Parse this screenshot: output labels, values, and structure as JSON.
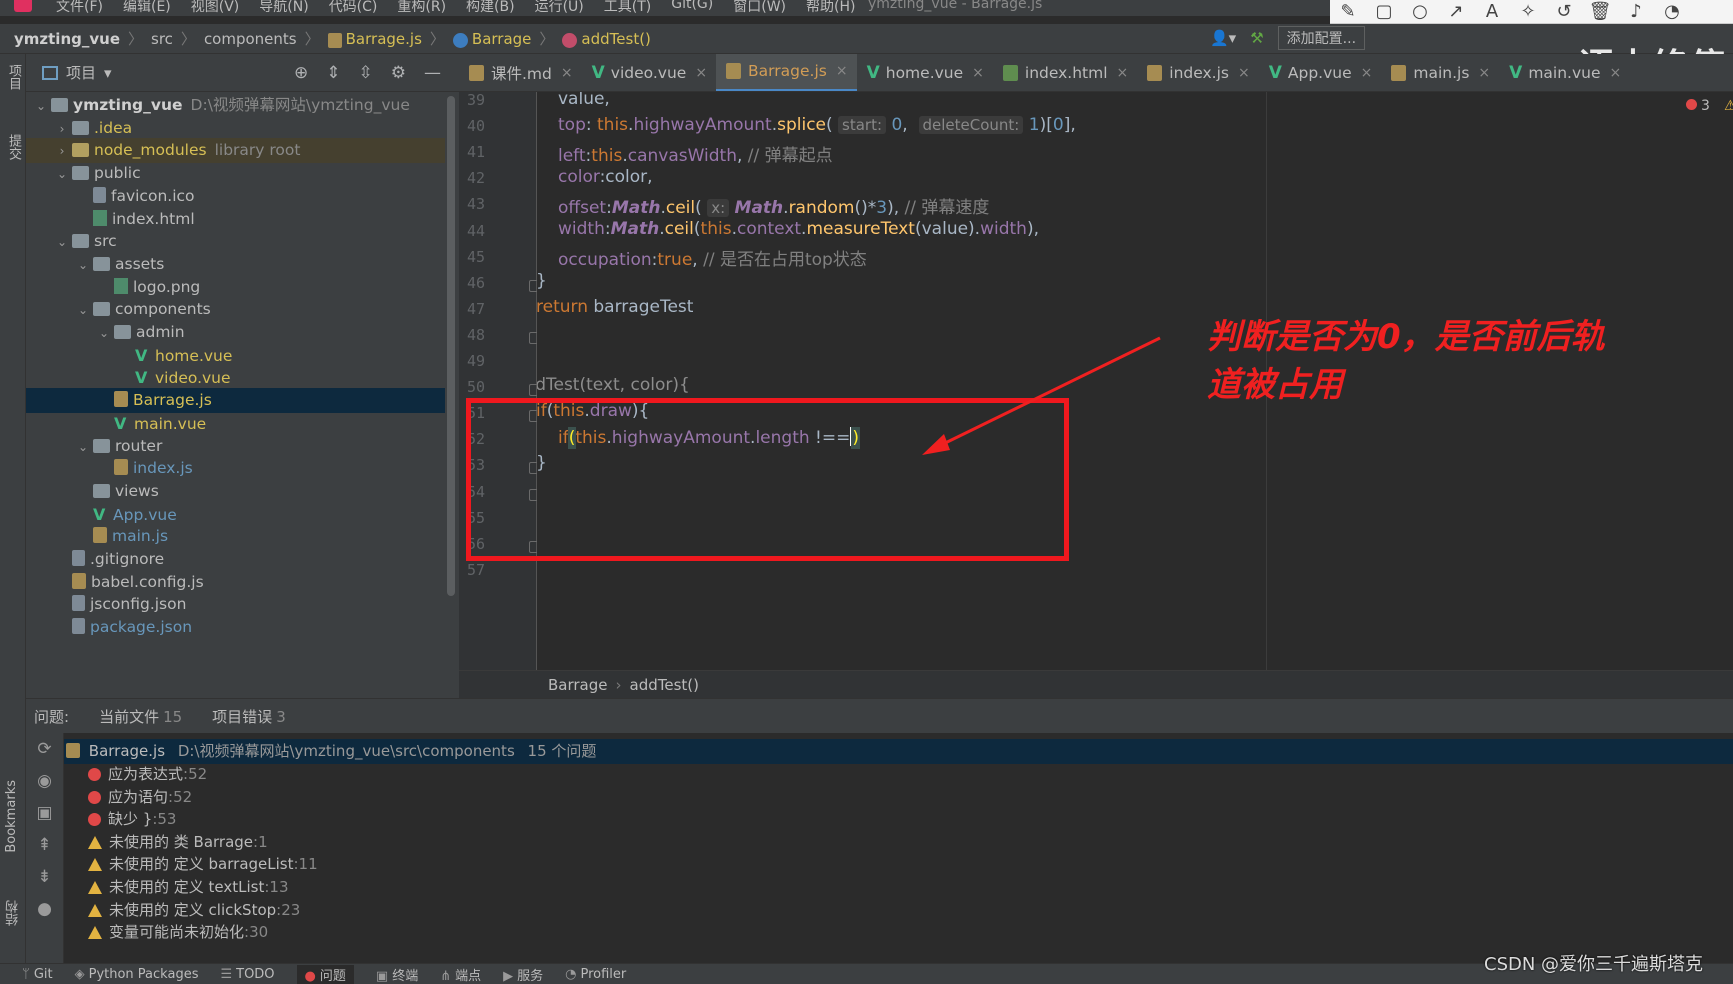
{
  "menubar": {
    "items": [
      "文件(F)",
      "编辑(E)",
      "视图(V)",
      "导航(N)",
      "代码(C)",
      "重构(R)",
      "构建(B)",
      "运行(U)",
      "工具(T)",
      "Git(G)",
      "窗口(W)",
      "帮助(H)"
    ],
    "window_title": "ymzting_vue - Barrage.js"
  },
  "navbar": {
    "project": "ymzting_vue",
    "crumbs": [
      "src",
      "components",
      "Barrage.js",
      "Barrage",
      "addTest()"
    ],
    "add_config": "添加配置...",
    "overlay_text": "语未终停"
  },
  "left_stripe": {
    "project": "项目",
    "commit": "提交",
    "bookmarks": "Bookmarks",
    "structure": "结构"
  },
  "project_panel": {
    "title": "项目",
    "tree": [
      {
        "label": "ymzting_vue",
        "extra": "D:\\视频弹幕网站\\ymzting_vue",
        "depth": 0,
        "arrow": "v",
        "icon": "folder",
        "style": "root"
      },
      {
        "label": ".idea",
        "extra": "",
        "depth": 1,
        "arrow": ">",
        "icon": "folder",
        "style": "yellow"
      },
      {
        "label": "node_modules",
        "extra": "library root",
        "depth": 1,
        "arrow": ">",
        "icon": "ffold",
        "style": "lib"
      },
      {
        "label": "public",
        "extra": "",
        "depth": 1,
        "arrow": "v",
        "icon": "folder",
        "style": ""
      },
      {
        "label": "favicon.ico",
        "extra": "",
        "depth": 2,
        "arrow": "",
        "icon": "file",
        "style": ""
      },
      {
        "label": "index.html",
        "extra": "",
        "depth": 2,
        "arrow": "",
        "icon": "img",
        "style": ""
      },
      {
        "label": "src",
        "extra": "",
        "depth": 1,
        "arrow": "v",
        "icon": "folder",
        "style": ""
      },
      {
        "label": "assets",
        "extra": "",
        "depth": 2,
        "arrow": "v",
        "icon": "folder",
        "style": ""
      },
      {
        "label": "logo.png",
        "extra": "",
        "depth": 3,
        "arrow": "",
        "icon": "img",
        "style": ""
      },
      {
        "label": "components",
        "extra": "",
        "depth": 2,
        "arrow": "v",
        "icon": "folder",
        "style": ""
      },
      {
        "label": "admin",
        "extra": "",
        "depth": 3,
        "arrow": "v",
        "icon": "folder",
        "style": ""
      },
      {
        "label": "home.vue",
        "extra": "",
        "depth": 4,
        "arrow": "",
        "icon": "vue",
        "style": "yellow"
      },
      {
        "label": "video.vue",
        "extra": "",
        "depth": 4,
        "arrow": "",
        "icon": "vue",
        "style": "yellow"
      },
      {
        "label": "Barrage.js",
        "extra": "",
        "depth": 3,
        "arrow": "",
        "icon": "js",
        "style": "sel-yellow"
      },
      {
        "label": "main.vue",
        "extra": "",
        "depth": 3,
        "arrow": "",
        "icon": "vue",
        "style": "yellow"
      },
      {
        "label": "router",
        "extra": "",
        "depth": 2,
        "arrow": "v",
        "icon": "folder",
        "style": ""
      },
      {
        "label": "index.js",
        "extra": "",
        "depth": 3,
        "arrow": "",
        "icon": "js",
        "style": "blue"
      },
      {
        "label": "views",
        "extra": "",
        "depth": 2,
        "arrow": "",
        "icon": "folder",
        "style": ""
      },
      {
        "label": "App.vue",
        "extra": "",
        "depth": 2,
        "arrow": "",
        "icon": "vue",
        "style": "blue"
      },
      {
        "label": "main.js",
        "extra": "",
        "depth": 2,
        "arrow": "",
        "icon": "js",
        "style": "blue"
      },
      {
        "label": ".gitignore",
        "extra": "",
        "depth": 1,
        "arrow": "",
        "icon": "file",
        "style": ""
      },
      {
        "label": "babel.config.js",
        "extra": "",
        "depth": 1,
        "arrow": "",
        "icon": "js",
        "style": ""
      },
      {
        "label": "jsconfig.json",
        "extra": "",
        "depth": 1,
        "arrow": "",
        "icon": "file",
        "style": ""
      },
      {
        "label": "package.json",
        "extra": "",
        "depth": 1,
        "arrow": "",
        "icon": "file",
        "style": "blue"
      }
    ]
  },
  "tabs": [
    {
      "label": "课件.md",
      "kind": "md",
      "active": false
    },
    {
      "label": "video.vue",
      "kind": "vue",
      "active": false
    },
    {
      "label": "Barrage.js",
      "kind": "js",
      "active": true
    },
    {
      "label": "home.vue",
      "kind": "vue",
      "active": false
    },
    {
      "label": "index.html",
      "kind": "html",
      "active": false
    },
    {
      "label": "index.js",
      "kind": "js",
      "active": false
    },
    {
      "label": "App.vue",
      "kind": "vue",
      "active": false
    },
    {
      "label": "main.js",
      "kind": "js",
      "active": false
    },
    {
      "label": "main.vue",
      "kind": "vue",
      "active": false
    }
  ],
  "editor": {
    "line_numbers": [
      "39",
      "40",
      "41",
      "42",
      "43",
      "44",
      "45",
      "46",
      "47",
      "48",
      "49",
      "50",
      "51",
      "52",
      "53",
      "54",
      "55",
      "56",
      "57"
    ],
    "error_count": "3",
    "breadcrumb": [
      "Barrage",
      "addTest()"
    ],
    "annotation": "判断是否为0，是否前后轨道被占用"
  },
  "problems": {
    "label": "问题:",
    "tabs": [
      {
        "label": "当前文件",
        "count": "15"
      },
      {
        "label": "项目错误",
        "count": "3"
      }
    ],
    "file": {
      "name": "Barrage.js",
      "path": "D:\\视频弹幕网站\\ymzting_vue\\src\\components",
      "count": "15 个问题"
    },
    "items": [
      {
        "type": "error",
        "text": "应为表达式",
        "line": ":52"
      },
      {
        "type": "error",
        "text": "应为语句",
        "line": ":52"
      },
      {
        "type": "error",
        "text": "缺少 }",
        "line": ":53"
      },
      {
        "type": "warning",
        "text": "未使用的 类 Barrage",
        "line": ":1"
      },
      {
        "type": "warning",
        "text": "未使用的 定义 barrageList",
        "line": ":11"
      },
      {
        "type": "warning",
        "text": "未使用的 定义 textList",
        "line": ":13"
      },
      {
        "type": "warning",
        "text": "未使用的 定义 clickStop",
        "line": ":23"
      },
      {
        "type": "warning",
        "text": "变量可能尚未初始化",
        "line": ":30"
      }
    ]
  },
  "bottombar": {
    "items": [
      {
        "label": "Git",
        "icon": "git-icon"
      },
      {
        "label": "Python Packages",
        "icon": "packages-icon"
      },
      {
        "label": "TODO",
        "icon": "todo-icon"
      },
      {
        "label": "问题",
        "icon": "problems-icon",
        "active": true
      },
      {
        "label": "终端",
        "icon": "terminal-icon"
      },
      {
        "label": "端点",
        "icon": "endpoints-icon"
      },
      {
        "label": "服务",
        "icon": "services-icon"
      },
      {
        "label": "Profiler",
        "icon": "profiler-icon"
      }
    ],
    "watermark": "CSDN @爱你三千遍斯塔克"
  }
}
